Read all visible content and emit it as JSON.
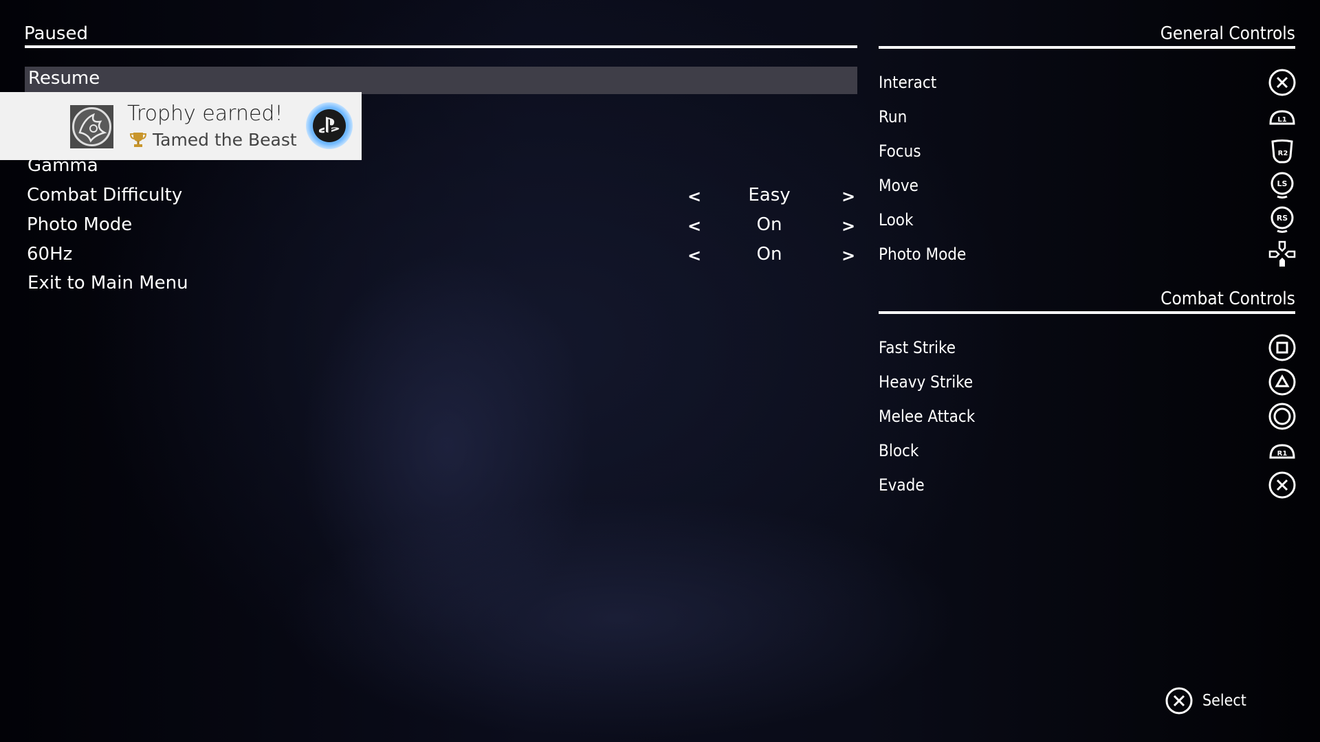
{
  "pause_menu": {
    "title": "Paused",
    "items": [
      {
        "label": "Resume",
        "selected": true
      },
      {
        "label": "Gamma"
      },
      {
        "label": "Combat Difficulty",
        "value": "Easy"
      },
      {
        "label": "Photo Mode",
        "value": "On"
      },
      {
        "label": "60Hz",
        "value": "On"
      },
      {
        "label": "Exit to Main Menu"
      }
    ],
    "prev_glyph": "<",
    "next_glyph": ">"
  },
  "trophy_toast": {
    "title": "Trophy earned!",
    "trophy_name": "Tamed the Beast",
    "trophy_icon": "trophy-icon",
    "trophy_color": "#c9962c",
    "glow_color": "#6fb8ff"
  },
  "general_controls": {
    "title": "General Controls",
    "items": [
      {
        "label": "Interact",
        "icon": "cross-button-icon"
      },
      {
        "label": "Run",
        "icon": "l1-button-icon"
      },
      {
        "label": "Focus",
        "icon": "r2-button-icon"
      },
      {
        "label": "Move",
        "icon": "left-stick-icon"
      },
      {
        "label": "Look",
        "icon": "right-stick-icon"
      },
      {
        "label": "Photo Mode",
        "icon": "dpad-down-icon"
      }
    ]
  },
  "combat_controls": {
    "title": "Combat Controls",
    "items": [
      {
        "label": "Fast Strike",
        "icon": "square-button-icon"
      },
      {
        "label": "Heavy Strike",
        "icon": "triangle-button-icon"
      },
      {
        "label": "Melee Attack",
        "icon": "circle-button-icon"
      },
      {
        "label": "Block",
        "icon": "r1-button-icon"
      },
      {
        "label": "Evade",
        "icon": "cross-button-icon"
      }
    ]
  },
  "footer": {
    "select_label": "Select",
    "select_icon": "cross-button-icon"
  },
  "colors": {
    "selected_row": "#3f3e48",
    "toast_bg": "#f1f1f1",
    "text": "#ffffff"
  }
}
